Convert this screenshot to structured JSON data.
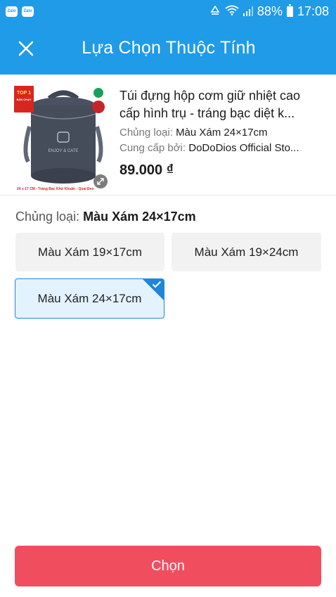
{
  "status_bar": {
    "left_apps": [
      "Zalo",
      "Zalo"
    ],
    "battery_pct": "88%",
    "time": "17:08",
    "icons": [
      "sync-icon",
      "wifi-icon",
      "signal-icon",
      "battery-icon"
    ]
  },
  "header": {
    "title": "Lựa Chọn Thuộc Tính",
    "close_icon": "close-icon"
  },
  "product": {
    "name_line1": "Túi đựng hộp cơm giữ nhiệt cao",
    "name_line2": "cấp hình trụ - tráng bạc diệt k...",
    "variant_label": "Chủng loại:",
    "variant_value": "Màu Xám 24×17cm",
    "seller_label": "Cung cấp bởi:",
    "seller_value": "DoDoDios Official Sto...",
    "price": "89.000 ₫",
    "badge_top": "TOP 1",
    "badge_sub": "BÁN CHẠY",
    "bag_text": "ENJOY & CATE",
    "image_caption": "24 x 17 CM - Tráng Bạc Khử Khuẩn - Quai Đeo"
  },
  "options": {
    "label": "Chủng loại:",
    "selected_value": "Màu Xám 24×17cm",
    "items": [
      {
        "label": "Màu Xám 19×17cm",
        "selected": false
      },
      {
        "label": "Màu Xám 19×24cm",
        "selected": false
      },
      {
        "label": "Màu Xám 24×17cm",
        "selected": true
      }
    ]
  },
  "footer": {
    "choose_label": "Chọn"
  },
  "colors": {
    "primary": "#1f9be8",
    "selected_border": "#1f86d8",
    "button": "#f04e5f"
  }
}
